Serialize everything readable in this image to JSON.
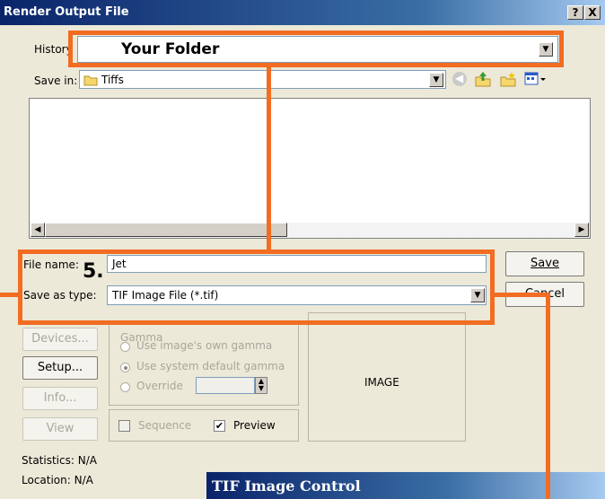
{
  "window": {
    "title": "Render Output File",
    "help_label": "?",
    "close_label": "X"
  },
  "history": {
    "label": "History",
    "value": "Your Folder"
  },
  "save_in": {
    "label": "Save in:",
    "value": "Tiffs"
  },
  "file_name": {
    "label": "File name:",
    "value": "Jet"
  },
  "save_as_type": {
    "label": "Save as type:",
    "value": "TIF Image File (*.tif)"
  },
  "buttons": {
    "save": "Save",
    "cancel": "Cancel",
    "devices": "Devices...",
    "setup": "Setup...",
    "info": "Info...",
    "view": "View"
  },
  "gamma": {
    "label": "Gamma",
    "opt1": "Use image's own gamma",
    "opt2": "Use system default gamma",
    "opt3": "Override"
  },
  "options": {
    "sequence": "Sequence",
    "preview": "Preview"
  },
  "preview_area": {
    "label": "IMAGE"
  },
  "stats": {
    "statistics": "Statistics: N/A",
    "location": "Location: N/A"
  },
  "annotation": {
    "step": "5."
  },
  "subwindow": {
    "title": "TIF Image Control"
  },
  "colors": {
    "accent": "#F26C22",
    "titlebar": "#0A246A",
    "dialog": "#ECE9D8"
  }
}
